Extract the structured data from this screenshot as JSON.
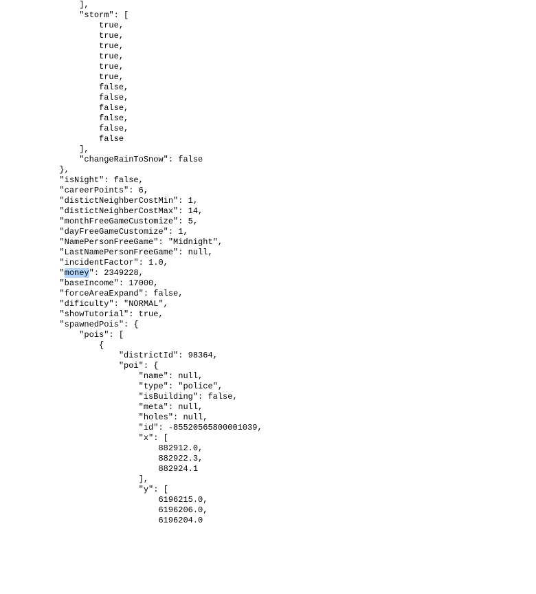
{
  "highlight_key": "money",
  "lines": [
    {
      "indent": 16,
      "text": "],"
    },
    {
      "indent": 16,
      "text": "\"storm\": ["
    },
    {
      "indent": 20,
      "text": "true,"
    },
    {
      "indent": 20,
      "text": "true,"
    },
    {
      "indent": 20,
      "text": "true,"
    },
    {
      "indent": 20,
      "text": "true,"
    },
    {
      "indent": 20,
      "text": "true,"
    },
    {
      "indent": 20,
      "text": "true,"
    },
    {
      "indent": 20,
      "text": "false,"
    },
    {
      "indent": 20,
      "text": "false,"
    },
    {
      "indent": 20,
      "text": "false,"
    },
    {
      "indent": 20,
      "text": "false,"
    },
    {
      "indent": 20,
      "text": "false,"
    },
    {
      "indent": 20,
      "text": "false"
    },
    {
      "indent": 16,
      "text": "],"
    },
    {
      "indent": 16,
      "text": "\"changeRainToSnow\": false"
    },
    {
      "indent": 12,
      "text": "},"
    },
    {
      "indent": 12,
      "text": "\"isNight\": false,"
    },
    {
      "indent": 12,
      "text": "\"careerPoints\": 6,"
    },
    {
      "indent": 12,
      "text": "\"distictNeighberCostMin\": 1,"
    },
    {
      "indent": 12,
      "text": "\"distictNeighberCostMax\": 14,"
    },
    {
      "indent": 12,
      "text": "\"monthFreeGameCustomize\": 5,"
    },
    {
      "indent": 12,
      "text": "\"dayFreeGameCustomize\": 1,"
    },
    {
      "indent": 12,
      "text": "\"NamePersonFreeGame\": \"Midnight\","
    },
    {
      "indent": 12,
      "text": "\"LastNamePersonFreeGame\": null,"
    },
    {
      "indent": 12,
      "text": "\"incidentFactor\": 1.0,"
    },
    {
      "indent": 12,
      "text": "\"money\": 2349228,",
      "highlight": true,
      "hl_key": "money"
    },
    {
      "indent": 12,
      "text": "\"baseIncome\": 17000,"
    },
    {
      "indent": 12,
      "text": "\"forceAreaExpand\": false,"
    },
    {
      "indent": 12,
      "text": "\"dificulty\": \"NORMAL\","
    },
    {
      "indent": 12,
      "text": "\"showTutorial\": true,"
    },
    {
      "indent": 12,
      "text": "\"spawnedPois\": {"
    },
    {
      "indent": 16,
      "text": "\"pois\": ["
    },
    {
      "indent": 20,
      "text": "{"
    },
    {
      "indent": 24,
      "text": "\"districtId\": 98364,"
    },
    {
      "indent": 24,
      "text": "\"poi\": {"
    },
    {
      "indent": 28,
      "text": "\"name\": null,"
    },
    {
      "indent": 28,
      "text": "\"type\": \"police\","
    },
    {
      "indent": 28,
      "text": "\"isBuilding\": false,"
    },
    {
      "indent": 28,
      "text": "\"meta\": null,"
    },
    {
      "indent": 28,
      "text": "\"holes\": null,"
    },
    {
      "indent": 28,
      "text": "\"id\": -85520565800001039,"
    },
    {
      "indent": 28,
      "text": "\"x\": ["
    },
    {
      "indent": 32,
      "text": "882912.0,"
    },
    {
      "indent": 32,
      "text": "882922.3,"
    },
    {
      "indent": 32,
      "text": "882924.1"
    },
    {
      "indent": 28,
      "text": "],"
    },
    {
      "indent": 28,
      "text": "\"y\": ["
    },
    {
      "indent": 32,
      "text": "6196215.0,"
    },
    {
      "indent": 32,
      "text": "6196206.0,"
    },
    {
      "indent": 32,
      "text": "6196204.0"
    }
  ],
  "chart_data": {
    "type": "table",
    "title": "JSON fragment — game save data",
    "data": {
      "storm": [
        true,
        true,
        true,
        true,
        true,
        true,
        false,
        false,
        false,
        false,
        false,
        false
      ],
      "changeRainToSnow": false,
      "isNight": false,
      "careerPoints": 6,
      "distictNeighberCostMin": 1,
      "distictNeighberCostMax": 14,
      "monthFreeGameCustomize": 5,
      "dayFreeGameCustomize": 1,
      "NamePersonFreeGame": "Midnight",
      "LastNamePersonFreeGame": null,
      "incidentFactor": 1.0,
      "money": 2349228,
      "baseIncome": 17000,
      "forceAreaExpand": false,
      "dificulty": "NORMAL",
      "showTutorial": true,
      "spawnedPois": {
        "pois": [
          {
            "districtId": 98364,
            "poi": {
              "name": null,
              "type": "police",
              "isBuilding": false,
              "meta": null,
              "holes": null,
              "id": -85520565800001039,
              "x": [
                882912.0,
                882922.3,
                882924.1
              ],
              "y": [
                6196215.0,
                6196206.0,
                6196204.0
              ]
            }
          }
        ]
      }
    }
  }
}
